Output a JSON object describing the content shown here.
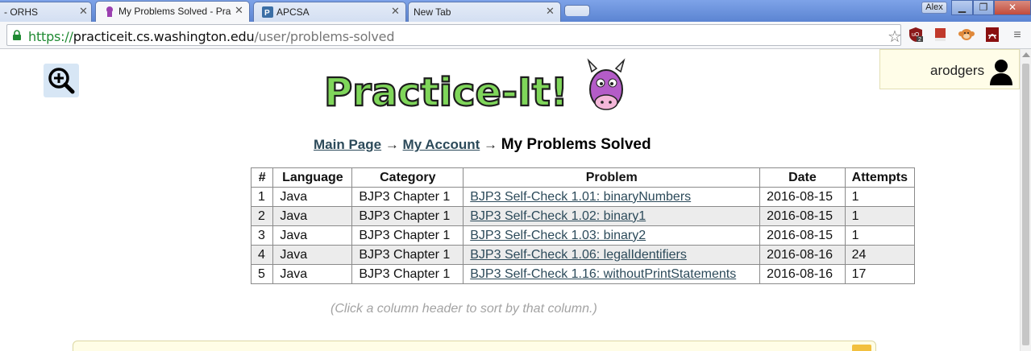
{
  "browser": {
    "tabs": [
      {
        "title": "- ORHS"
      },
      {
        "title": "My Problems Solved - Pra"
      },
      {
        "title": "APCSA"
      },
      {
        "title": "New Tab"
      }
    ],
    "profile_name": "Alex",
    "url": {
      "scheme": "https://",
      "host": "practiceit.cs.washington.edu",
      "path": "/user/problems-solved"
    }
  },
  "header": {
    "username": "arodgers",
    "logo_text": "Practice-It!"
  },
  "breadcrumb": {
    "main_page": "Main Page",
    "arrow1": " → ",
    "my_account": "My Account",
    "arrow2": " → ",
    "current": "My Problems Solved"
  },
  "table": {
    "headers": [
      "#",
      "Language",
      "Category",
      "Problem",
      "Date",
      "Attempts"
    ],
    "rows": [
      {
        "num": "1",
        "language": "Java",
        "category": "BJP3 Chapter 1",
        "problem": "BJP3 Self-Check 1.01: binaryNumbers",
        "date": "2016-08-15",
        "attempts": "1"
      },
      {
        "num": "2",
        "language": "Java",
        "category": "BJP3 Chapter 1",
        "problem": "BJP3 Self-Check 1.02: binary1",
        "date": "2016-08-15",
        "attempts": "1"
      },
      {
        "num": "3",
        "language": "Java",
        "category": "BJP3 Chapter 1",
        "problem": "BJP3 Self-Check 1.03: binary2",
        "date": "2016-08-15",
        "attempts": "1"
      },
      {
        "num": "4",
        "language": "Java",
        "category": "BJP3 Chapter 1",
        "problem": "BJP3 Self-Check 1.06: legalIdentifiers",
        "date": "2016-08-16",
        "attempts": "24"
      },
      {
        "num": "5",
        "language": "Java",
        "category": "BJP3 Chapter 1",
        "problem": "BJP3 Self-Check 1.16: withoutPrintStatements",
        "date": "2016-08-16",
        "attempts": "17"
      }
    ]
  },
  "hint": "(Click a column header to sort by that column.)",
  "colors": {
    "link": "#2c4a5a",
    "url_scheme": "#1f8a32",
    "row_alt": "#ececec",
    "user_box": "#fffde8"
  }
}
